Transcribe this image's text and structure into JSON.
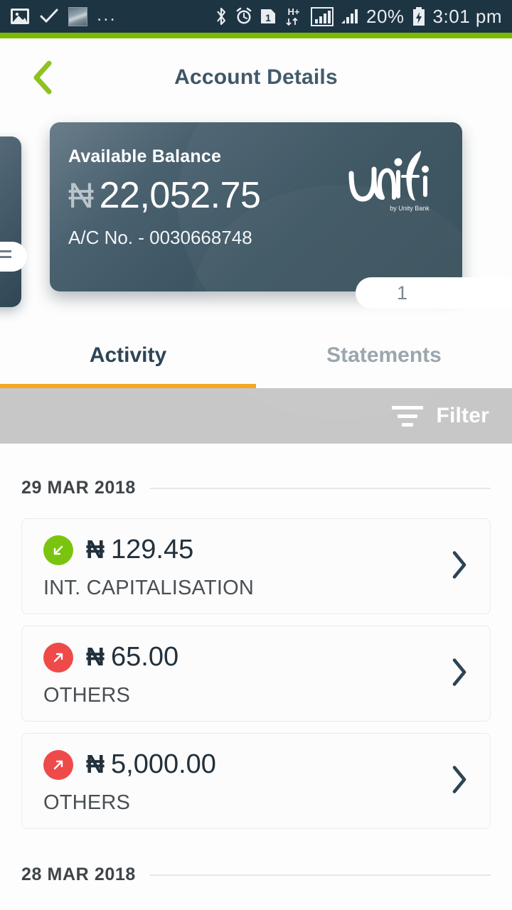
{
  "statusbar": {
    "left_icons": [
      "photo-icon",
      "check-icon",
      "image-thumbnail",
      "overflow-dots"
    ],
    "dots": "...",
    "right_icons": [
      "bluetooth-icon",
      "alarm-icon",
      "sim-1-icon",
      "hplus-data-icon",
      "signal-1-icon",
      "signal-2-icon"
    ],
    "sim_label": "1",
    "network_type": "H+",
    "battery_percent": "20%",
    "time": "3:01 pm"
  },
  "header": {
    "title": "Account Details",
    "back_icon": "chevron-left-icon"
  },
  "card": {
    "balance_label": "Available Balance",
    "currency_symbol": "₦",
    "balance_amount": "22,052.75",
    "account_line": "A/C No. - 0030668748",
    "logo_name": "unifi",
    "logo_tagline": "by Unity Bank",
    "page_indicator": "1"
  },
  "tabs": [
    {
      "label": "Activity",
      "active": true
    },
    {
      "label": "Statements",
      "active": false
    }
  ],
  "filter": {
    "label": "Filter",
    "icon": "filter-lines-icon"
  },
  "transaction_groups": [
    {
      "date": "29 MAR 2018",
      "transactions": [
        {
          "currency_symbol": "₦",
          "amount": "129.45",
          "description": "INT. CAPITALISATION",
          "direction": "credit",
          "direction_icon": "arrow-down-left-icon",
          "chevron_icon": "chevron-right-icon"
        },
        {
          "currency_symbol": "₦",
          "amount": "65.00",
          "description": "OTHERS",
          "direction": "debit",
          "direction_icon": "arrow-up-right-icon",
          "chevron_icon": "chevron-right-icon"
        },
        {
          "currency_symbol": "₦",
          "amount": "5,000.00",
          "description": "OTHERS",
          "direction": "debit",
          "direction_icon": "arrow-up-right-icon",
          "chevron_icon": "chevron-right-icon"
        }
      ]
    },
    {
      "date": "28 MAR 2018",
      "transactions": []
    }
  ],
  "colors": {
    "statusbar_bg": "#1d3443",
    "accent_green": "#7cb900",
    "tab_indicator": "#f5a623",
    "card_dark": "#344d59",
    "credit_green": "#7ac40f",
    "debit_red": "#ef4a4a",
    "title_navy": "#3d5666",
    "filter_bg": "#c7c7c7"
  }
}
